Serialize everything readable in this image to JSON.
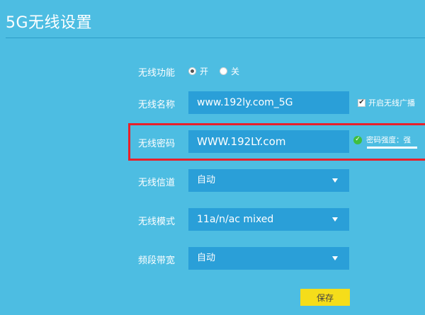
{
  "title": "5G无线设置",
  "wireless_function": {
    "label": "无线功能",
    "options": [
      {
        "label": "开",
        "selected": true
      },
      {
        "label": "关",
        "selected": false
      }
    ]
  },
  "wireless_name": {
    "label": "无线名称",
    "value": "www.192ly.com_5G",
    "broadcast_checkbox": {
      "label": "开启无线广播",
      "checked": true,
      "mark": "✔"
    }
  },
  "wireless_password": {
    "label": "无线密码",
    "value": "WWW.192LY.com",
    "strength_text": "密码强度：强",
    "strength_icon": "check-circle-icon",
    "highlight_color": "#e8202a"
  },
  "wireless_channel": {
    "label": "无线信道",
    "value": "自动"
  },
  "wireless_mode": {
    "label": "无线模式",
    "value": "11a/n/ac mixed"
  },
  "bandwidth": {
    "label": "频段带宽",
    "value": "自动"
  },
  "save_label": "保存",
  "colors": {
    "background": "#4dbde2",
    "field": "#2a9fd8",
    "save_button": "#f5dd1a",
    "success": "#3fbf3f"
  }
}
